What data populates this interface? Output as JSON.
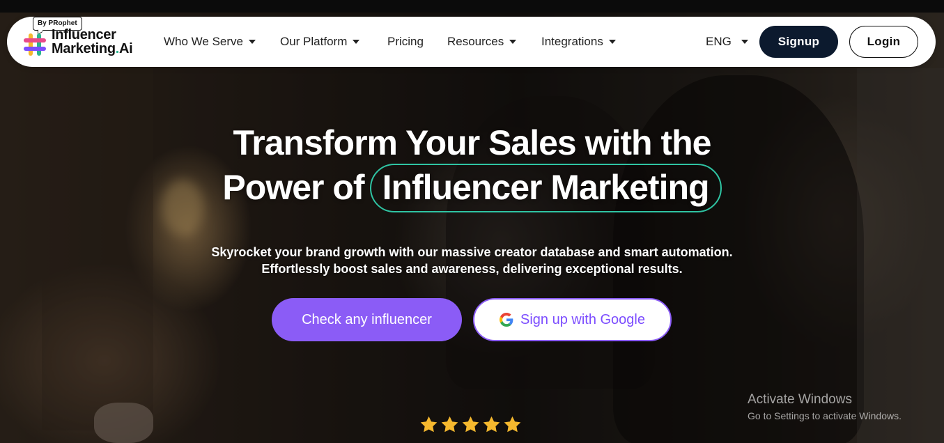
{
  "brand": {
    "badge": "By PRophet",
    "name_line1": "Influencer",
    "name_line2a": "Marketing",
    "name_line2b": ".",
    "name_line2c": "Ai"
  },
  "nav": {
    "items": [
      {
        "label": "Who We Serve",
        "dropdown": true
      },
      {
        "label": "Our Platform",
        "dropdown": true
      },
      {
        "label": "Pricing",
        "dropdown": false
      },
      {
        "label": "Resources",
        "dropdown": true
      },
      {
        "label": "Integrations",
        "dropdown": true
      }
    ],
    "language": "ENG",
    "signup_label": "Signup",
    "login_label": "Login"
  },
  "hero": {
    "headline_line1": "Transform Your Sales with the",
    "headline_line2_prefix": "Power of",
    "headline_highlight": "Influencer Marketing",
    "subtext_line1": "Skyrocket your brand growth with our massive creator database and smart automation.",
    "subtext_line2": "Effortlessly boost sales and awareness, delivering exceptional results.",
    "cta_primary": "Check any influencer",
    "cta_google": "Sign up with Google",
    "rating_stars": 5
  },
  "watermark": {
    "line1": "Activate Windows",
    "line2": "Go to Settings to activate Windows."
  },
  "colors": {
    "accent_purple": "#8b5cf6",
    "accent_teal": "#2fc4a3",
    "nav_dark": "#0c1a2e",
    "star_gold": "#f5b82e"
  }
}
